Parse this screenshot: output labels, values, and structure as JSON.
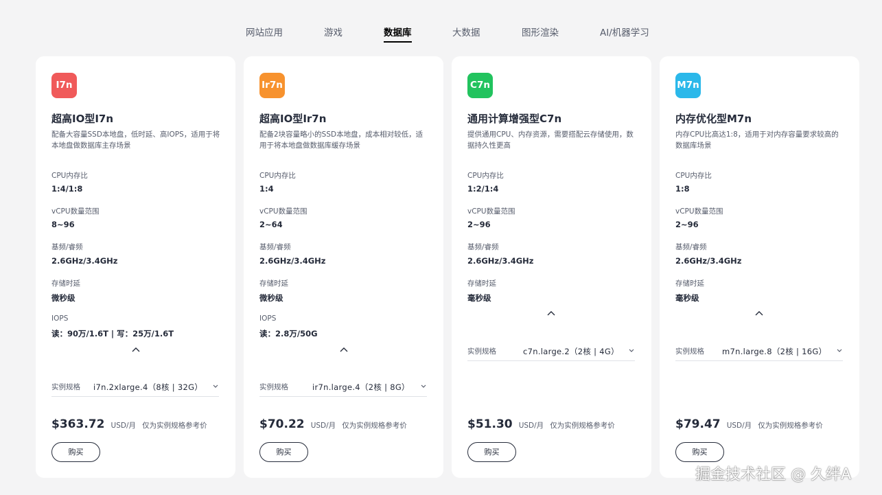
{
  "tabs": [
    {
      "label": "网站应用"
    },
    {
      "label": "游戏"
    },
    {
      "label": "数据库"
    },
    {
      "label": "大数据"
    },
    {
      "label": "图形渲染"
    },
    {
      "label": "AI/机器学习"
    }
  ],
  "active_tab": "数据库",
  "cards": [
    {
      "badge": "I7n",
      "badge_color": "#f05a5a",
      "title": "超高IO型I7n",
      "desc": "配备大容量SSD本地盘，低时延、高IOPS，适用于将本地盘做数据库主存场景",
      "specs": [
        {
          "label": "CPU内存比",
          "value": "1:4/1:8"
        },
        {
          "label": "vCPU数量范围",
          "value": "8~96"
        },
        {
          "label": "基频/睿频",
          "value": "2.6GHz/3.4GHz"
        },
        {
          "label": "存储时延",
          "value": "微秒级"
        },
        {
          "label": "IOPS",
          "value": "读：90万/1.6T | 写：25万/1.6T"
        }
      ],
      "instance_label": "实例规格",
      "instance_value": "i7n.2xlarge.4（8核 | 32G）",
      "price": "$363.72",
      "price_unit": "USD/月",
      "price_note": "仅为实例规格参考价",
      "buy_label": "购买"
    },
    {
      "badge": "Ir7n",
      "badge_color": "#f7922e",
      "title": "超高IO型Ir7n",
      "desc": "配备2块容量略小的SSD本地盘，成本相对较低，适用于将本地盘做数据库缓存场景",
      "specs": [
        {
          "label": "CPU内存比",
          "value": "1:4"
        },
        {
          "label": "vCPU数量范围",
          "value": "2~64"
        },
        {
          "label": "基频/睿频",
          "value": "2.6GHz/3.4GHz"
        },
        {
          "label": "存储时延",
          "value": "微秒级"
        },
        {
          "label": "IOPS",
          "value": "读：2.8万/50G"
        }
      ],
      "instance_label": "实例规格",
      "instance_value": "ir7n.large.4（2核 | 8G）",
      "price": "$70.22",
      "price_unit": "USD/月",
      "price_note": "仅为实例规格参考价",
      "buy_label": "购买"
    },
    {
      "badge": "C7n",
      "badge_color": "#22c35e",
      "title": "通用计算增强型C7n",
      "desc": "提供通用CPU、内存资源，需要搭配云存储使用，数据持久性更高",
      "specs": [
        {
          "label": "CPU内存比",
          "value": "1:2/1:4"
        },
        {
          "label": "vCPU数量范围",
          "value": "2~96"
        },
        {
          "label": "基频/睿频",
          "value": "2.6GHz/3.4GHz"
        },
        {
          "label": "存储时延",
          "value": "毫秒级"
        }
      ],
      "instance_label": "实例规格",
      "instance_value": "c7n.large.2（2核 | 4G）",
      "price": "$51.30",
      "price_unit": "USD/月",
      "price_note": "仅为实例规格参考价",
      "buy_label": "购买"
    },
    {
      "badge": "M7n",
      "badge_color": "#2bb8ea",
      "title": "内存优化型M7n",
      "desc": "内存CPU比高达1:8，适用于对内存容量要求较高的数据库场景",
      "specs": [
        {
          "label": "CPU内存比",
          "value": "1:8"
        },
        {
          "label": "vCPU数量范围",
          "value": "2~96"
        },
        {
          "label": "基频/睿频",
          "value": "2.6GHz/3.4GHz"
        },
        {
          "label": "存储时延",
          "value": "毫秒级"
        }
      ],
      "instance_label": "实例规格",
      "instance_value": "m7n.large.8（2核 | 16G）",
      "price": "$79.47",
      "price_unit": "USD/月",
      "price_note": "仅为实例规格参考价",
      "buy_label": "购买"
    }
  ],
  "watermark": "掘金技术社区 @ 久绊A"
}
